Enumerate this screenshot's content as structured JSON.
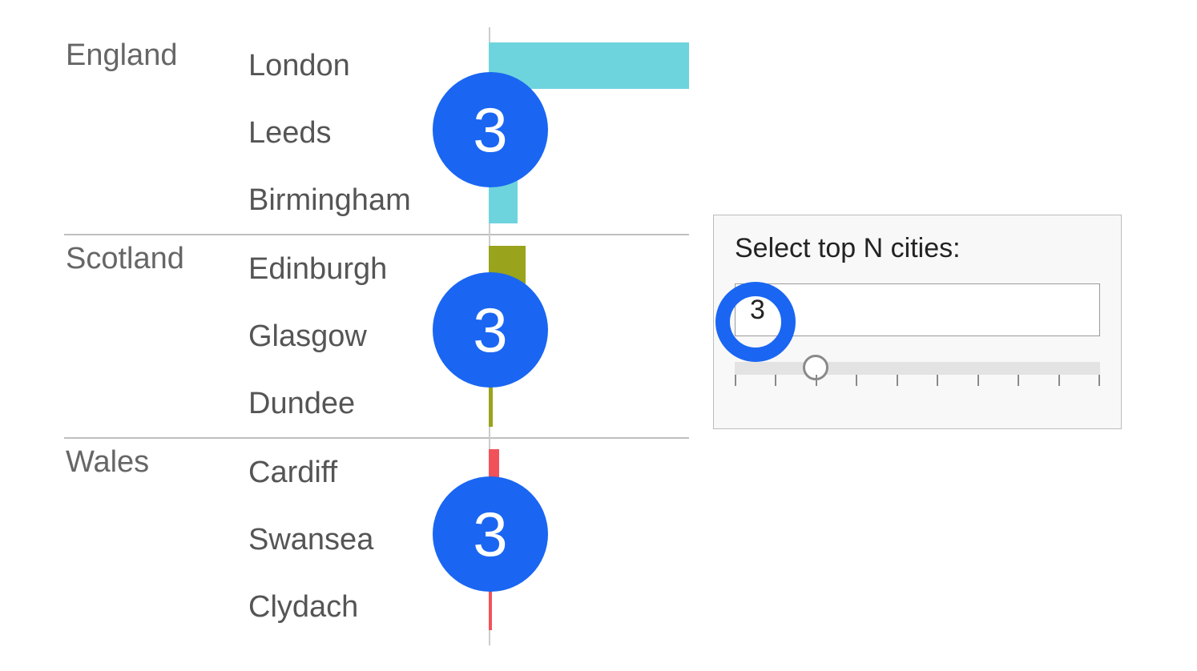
{
  "parameter_panel": {
    "title": "Select top N cities:",
    "value": "3",
    "slider": {
      "min": 1,
      "max": 10,
      "step": 1,
      "value": 3,
      "ticks": 10
    }
  },
  "annotations": {
    "badge_value": "3"
  },
  "chart_data": {
    "type": "bar",
    "title": "",
    "xlabel": "",
    "ylabel": "",
    "xlim": [
      0,
      700
    ],
    "groups": [
      {
        "name": "England",
        "color": "#6dd4de",
        "cities": [
          {
            "name": "London",
            "value": 700
          },
          {
            "name": "Leeds",
            "value": 80
          },
          {
            "name": "Birmingham",
            "value": 100
          }
        ]
      },
      {
        "name": "Scotland",
        "color": "#9aa31c",
        "cities": [
          {
            "name": "Edinburgh",
            "value": 130
          },
          {
            "name": "Glasgow",
            "value": 65
          },
          {
            "name": "Dundee",
            "value": 15
          }
        ]
      },
      {
        "name": "Wales",
        "color": "#f1525a",
        "cities": [
          {
            "name": "Cardiff",
            "value": 35
          },
          {
            "name": "Swansea",
            "value": 25
          },
          {
            "name": "Clydach",
            "value": 10
          }
        ]
      }
    ]
  }
}
